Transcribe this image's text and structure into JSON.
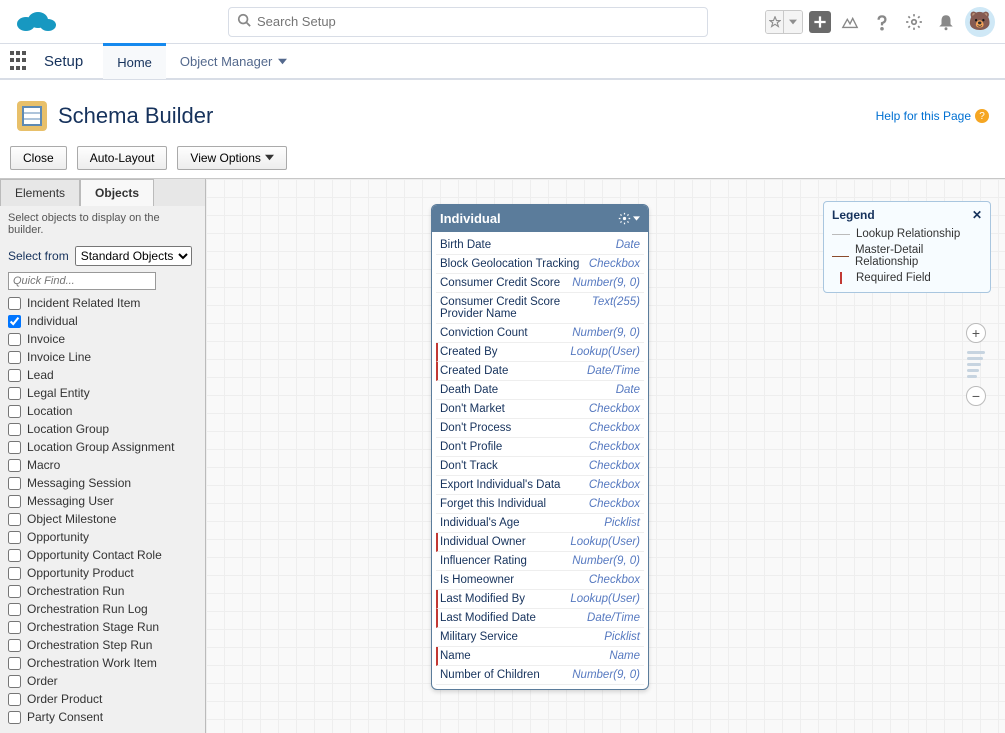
{
  "header": {
    "search_placeholder": "Search Setup"
  },
  "tabbar": {
    "setup": "Setup",
    "home": "Home",
    "object_manager": "Object Manager"
  },
  "page": {
    "title": "Schema Builder",
    "help": "Help for this Page"
  },
  "toolbar": {
    "close": "Close",
    "auto_layout": "Auto-Layout",
    "view_options": "View Options"
  },
  "sidebar": {
    "tab_elements": "Elements",
    "tab_objects": "Objects",
    "hint": "Select objects to display on the builder.",
    "select_label": "Select from",
    "select_value": "Standard Objects",
    "quick_find": "Quick Find...",
    "items": [
      {
        "label": "Incident Related Item",
        "checked": false
      },
      {
        "label": "Individual",
        "checked": true
      },
      {
        "label": "Invoice",
        "checked": false
      },
      {
        "label": "Invoice Line",
        "checked": false
      },
      {
        "label": "Lead",
        "checked": false
      },
      {
        "label": "Legal Entity",
        "checked": false
      },
      {
        "label": "Location",
        "checked": false
      },
      {
        "label": "Location Group",
        "checked": false
      },
      {
        "label": "Location Group Assignment",
        "checked": false
      },
      {
        "label": "Macro",
        "checked": false
      },
      {
        "label": "Messaging Session",
        "checked": false
      },
      {
        "label": "Messaging User",
        "checked": false
      },
      {
        "label": "Object Milestone",
        "checked": false
      },
      {
        "label": "Opportunity",
        "checked": false
      },
      {
        "label": "Opportunity Contact Role",
        "checked": false
      },
      {
        "label": "Opportunity Product",
        "checked": false
      },
      {
        "label": "Orchestration Run",
        "checked": false
      },
      {
        "label": "Orchestration Run Log",
        "checked": false
      },
      {
        "label": "Orchestration Stage Run",
        "checked": false
      },
      {
        "label": "Orchestration Step Run",
        "checked": false
      },
      {
        "label": "Orchestration Work Item",
        "checked": false
      },
      {
        "label": "Order",
        "checked": false
      },
      {
        "label": "Order Product",
        "checked": false
      },
      {
        "label": "Party Consent",
        "checked": false
      }
    ]
  },
  "card": {
    "title": "Individual",
    "fields": [
      {
        "name": "Birth Date",
        "type": "Date",
        "req": false
      },
      {
        "name": "Block Geolocation Tracking",
        "type": "Checkbox",
        "req": false
      },
      {
        "name": "Consumer Credit Score",
        "type": "Number(9, 0)",
        "req": false
      },
      {
        "name": "Consumer Credit Score Provider Name",
        "type": "Text(255)",
        "req": false
      },
      {
        "name": "Conviction Count",
        "type": "Number(9, 0)",
        "req": false
      },
      {
        "name": "Created By",
        "type": "Lookup(User)",
        "req": true
      },
      {
        "name": "Created Date",
        "type": "Date/Time",
        "req": true
      },
      {
        "name": "Death Date",
        "type": "Date",
        "req": false
      },
      {
        "name": "Don't Market",
        "type": "Checkbox",
        "req": false
      },
      {
        "name": "Don't Process",
        "type": "Checkbox",
        "req": false
      },
      {
        "name": "Don't Profile",
        "type": "Checkbox",
        "req": false
      },
      {
        "name": "Don't Track",
        "type": "Checkbox",
        "req": false
      },
      {
        "name": "Export Individual's Data",
        "type": "Checkbox",
        "req": false
      },
      {
        "name": "Forget this Individual",
        "type": "Checkbox",
        "req": false
      },
      {
        "name": "Individual's Age",
        "type": "Picklist",
        "req": false
      },
      {
        "name": "Individual Owner",
        "type": "Lookup(User)",
        "req": true
      },
      {
        "name": "Influencer Rating",
        "type": "Number(9, 0)",
        "req": false
      },
      {
        "name": "Is Homeowner",
        "type": "Checkbox",
        "req": false
      },
      {
        "name": "Last Modified By",
        "type": "Lookup(User)",
        "req": true
      },
      {
        "name": "Last Modified Date",
        "type": "Date/Time",
        "req": true
      },
      {
        "name": "Military Service",
        "type": "Picklist",
        "req": false
      },
      {
        "name": "Name",
        "type": "Name",
        "req": true
      },
      {
        "name": "Number of Children",
        "type": "Number(9, 0)",
        "req": false
      }
    ]
  },
  "legend": {
    "title": "Legend",
    "lookup": "Lookup Relationship",
    "master": "Master-Detail Relationship",
    "required": "Required Field"
  }
}
